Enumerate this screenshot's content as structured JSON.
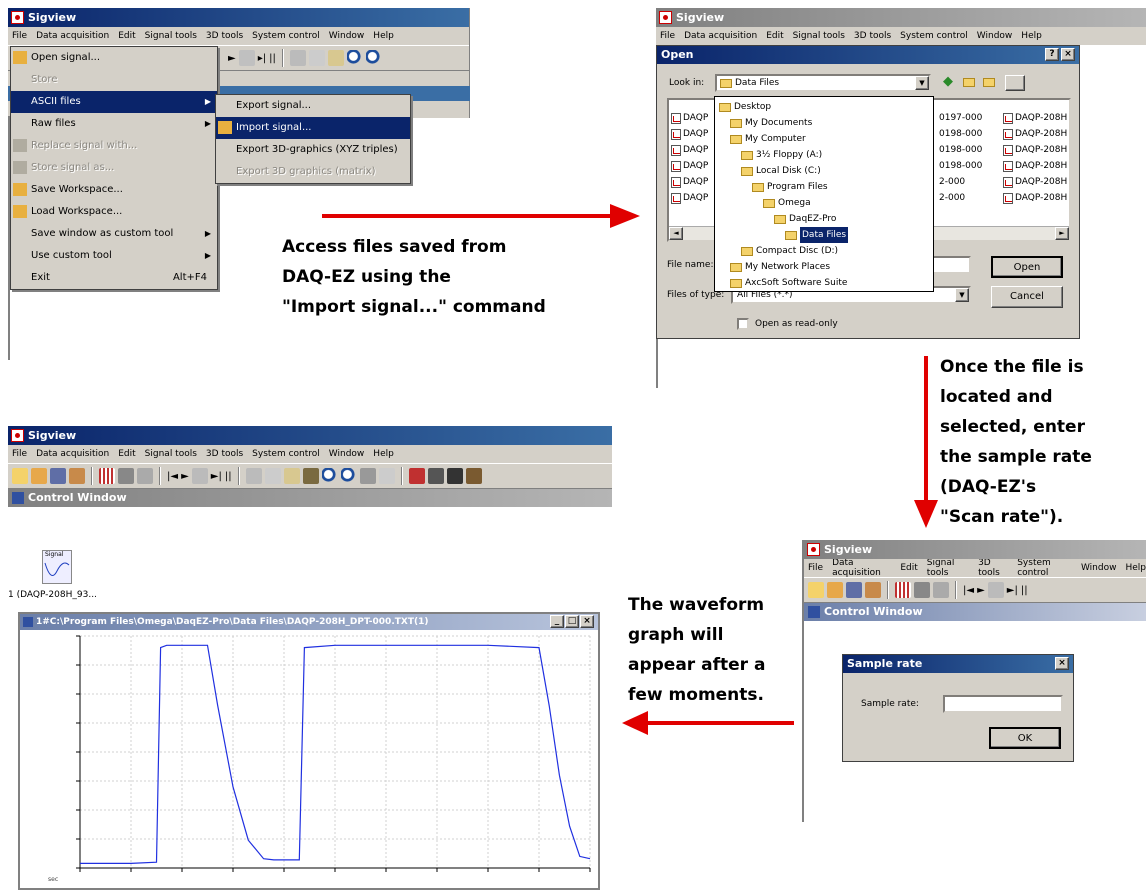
{
  "menubar_items": [
    "File",
    "Data acquisition",
    "Edit",
    "Signal tools",
    "3D tools",
    "System control",
    "Window",
    "Help"
  ],
  "panel1": {
    "title": "Sigview",
    "file_menu": [
      {
        "label": "Open signal...",
        "enabled": true,
        "icon": "open-folder-icon"
      },
      {
        "label": "Store",
        "enabled": false
      },
      {
        "sep": true
      },
      {
        "label": "ASCII files",
        "enabled": true,
        "highlight": true,
        "submenu": true
      },
      {
        "label": "Raw files",
        "enabled": true,
        "submenu": true
      },
      {
        "sep": true
      },
      {
        "label": "Replace signal with...",
        "enabled": false,
        "icon": "replace-icon"
      },
      {
        "sep": true
      },
      {
        "label": "Store signal as...",
        "enabled": false,
        "icon": "save-icon"
      },
      {
        "sep": true
      },
      {
        "label": "Save Workspace...",
        "enabled": true,
        "icon": "save-workspace-icon"
      },
      {
        "label": "Load Workspace...",
        "enabled": true,
        "icon": "load-workspace-icon"
      },
      {
        "sep": true
      },
      {
        "label": "Save window as custom tool",
        "enabled": true,
        "submenu": true
      },
      {
        "label": "Use custom tool",
        "enabled": true,
        "submenu": true
      },
      {
        "sep": true
      },
      {
        "label": "Exit",
        "enabled": true,
        "accel": "Alt+F4"
      }
    ],
    "ascii_submenu": [
      {
        "label": "Export signal...",
        "enabled": true
      },
      {
        "label": "Import signal...",
        "enabled": true,
        "highlight": true,
        "icon": "import-folder-icon"
      },
      {
        "label": "Export 3D-graphics (XYZ triples)",
        "enabled": true
      },
      {
        "label": "Export 3D graphics (matrix)",
        "enabled": false
      }
    ]
  },
  "annotation1": [
    "Access files saved from",
    "DAQ-EZ using the",
    "\"Import signal...\" command"
  ],
  "panel2": {
    "title": "Sigview",
    "dialog_title": "Open",
    "look_in_label": "Look in:",
    "look_in_value": "Data Files",
    "tree": [
      {
        "label": "Desktop",
        "level": 0
      },
      {
        "label": "My Documents",
        "level": 1
      },
      {
        "label": "My Computer",
        "level": 1
      },
      {
        "label": "3½ Floppy (A:)",
        "level": 2
      },
      {
        "label": "Local Disk (C:)",
        "level": 2
      },
      {
        "label": "Program Files",
        "level": 3
      },
      {
        "label": "Omega",
        "level": 4
      },
      {
        "label": "DaqEZ-Pro",
        "level": 5
      },
      {
        "label": "Data Files",
        "level": 6,
        "selected": true
      },
      {
        "label": "Compact Disc (D:)",
        "level": 2
      },
      {
        "label": "My Network Places",
        "level": 1
      },
      {
        "label": "AxcSoft Software Suite",
        "level": 1
      }
    ],
    "files_col1": [
      "DAQP",
      "DAQP",
      "DAQP",
      "DAQP",
      "DAQP",
      "DAQP"
    ],
    "files_col2": [
      "0197-000",
      "0198-000",
      "0198-000",
      "0198-000",
      "2-000",
      "2-000"
    ],
    "files_col3": [
      "DAQP-208H",
      "DAQP-208H",
      "DAQP-208H",
      "DAQP-208H",
      "DAQP-208H",
      "DAQP-208H"
    ],
    "file_name_label": "File name:",
    "files_of_type_label": "Files of type:",
    "files_of_type_value": "All Files (*.*)",
    "open_button": "Open",
    "cancel_button": "Cancel",
    "readonly_label": "Open as read-only"
  },
  "annotation2": [
    "Once the file is",
    "located and",
    "selected, enter",
    "the sample rate",
    "(DAQ-EZ's",
    "\"Scan rate\")."
  ],
  "panel3": {
    "title": "Sigview",
    "control_window_title": "Control Window",
    "dialog_title": "Sample rate",
    "sample_rate_label": "Sample rate:",
    "sample_rate_value": "",
    "ok_button": "OK"
  },
  "annotation3": [
    "The waveform",
    "graph will",
    "appear after a",
    "few moments."
  ],
  "panel4": {
    "title": "Sigview",
    "control_window_title": "Control Window",
    "signal_icon_label": "Signal",
    "signal_item_label": "1 (DAQP-208H_93...",
    "graph_title": "1#C:\\Program Files\\Omega\\DaqEZ-Pro\\Data Files\\DAQP-208H_DPT-000.TXT(1)",
    "bottom_label": "sec"
  },
  "chart_data": {
    "type": "line",
    "title": "",
    "xlabel": "",
    "ylabel": "",
    "ylim": [
      0,
      1
    ],
    "grid": true,
    "series": [
      {
        "x": [
          0,
          0.05,
          0.1,
          0.15,
          0.158,
          0.17,
          0.2,
          0.25,
          0.27,
          0.3,
          0.33,
          0.36,
          0.38,
          0.4,
          0.43,
          0.44,
          0.5,
          0.6,
          0.7,
          0.8,
          0.9,
          0.92,
          0.94,
          0.96,
          0.98,
          1.0
        ],
        "values": [
          0.02,
          0.02,
          0.02,
          0.025,
          0.95,
          0.96,
          0.96,
          0.96,
          0.7,
          0.35,
          0.12,
          0.04,
          0.035,
          0.035,
          0.035,
          0.95,
          0.96,
          0.96,
          0.96,
          0.96,
          0.95,
          0.7,
          0.4,
          0.18,
          0.05,
          0.04
        ]
      }
    ]
  }
}
